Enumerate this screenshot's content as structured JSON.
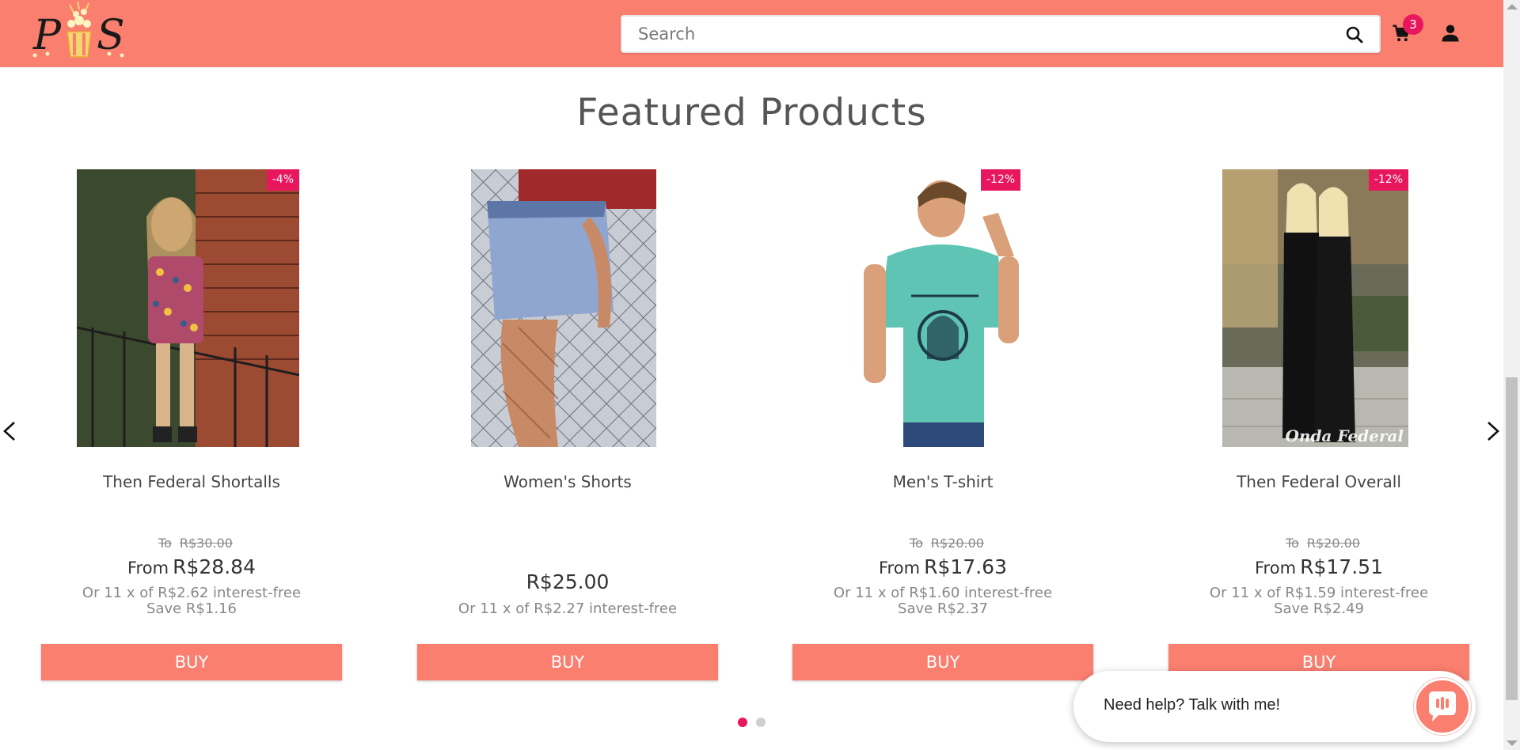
{
  "header": {
    "logo_text": "PS",
    "search_placeholder": "Search",
    "cart_count": "3",
    "icons": [
      "search-icon",
      "cart-icon",
      "user-icon"
    ],
    "background_color": "#fa7f6f"
  },
  "section": {
    "title": "Featured Products"
  },
  "products": [
    {
      "name": "Then Federal Shortalls",
      "discount": "-4%",
      "old_price_prefix": "To",
      "old_price": "R$30.00",
      "from_label": "From",
      "price": "R$28.84",
      "installments": "Or 11 x of R$2.62 interest-free",
      "save": "Save R$1.16",
      "buy_label": "BUY"
    },
    {
      "name": "Women's Shorts",
      "price": "R$25.00",
      "installments": "Or 11 x of R$2.27 interest-free",
      "buy_label": "BUY"
    },
    {
      "name": "Men's T-shirt",
      "discount": "-12%",
      "old_price_prefix": "To",
      "old_price": "R$20.00",
      "from_label": "From",
      "price": "R$17.63",
      "installments": "Or 11 x of R$1.60 interest-free",
      "save": "Save R$2.37",
      "buy_label": "BUY"
    },
    {
      "name": "Then Federal Overall",
      "discount": "-12%",
      "old_price_prefix": "To",
      "old_price": "R$20.00",
      "from_label": "From",
      "price": "R$17.51",
      "installments": "Or 11 x of R$1.59 interest-free",
      "save": "Save R$2.49",
      "buy_label": "BUY",
      "image_watermark": "Onda Federal"
    }
  ],
  "carousel": {
    "pages": 2,
    "active_page": 1
  },
  "chat": {
    "text": "Need help? Talk with me!"
  },
  "colors": {
    "accent": "#fa7f6f",
    "badge": "#e8175d",
    "dot_inactive": "#cfcfcf"
  }
}
